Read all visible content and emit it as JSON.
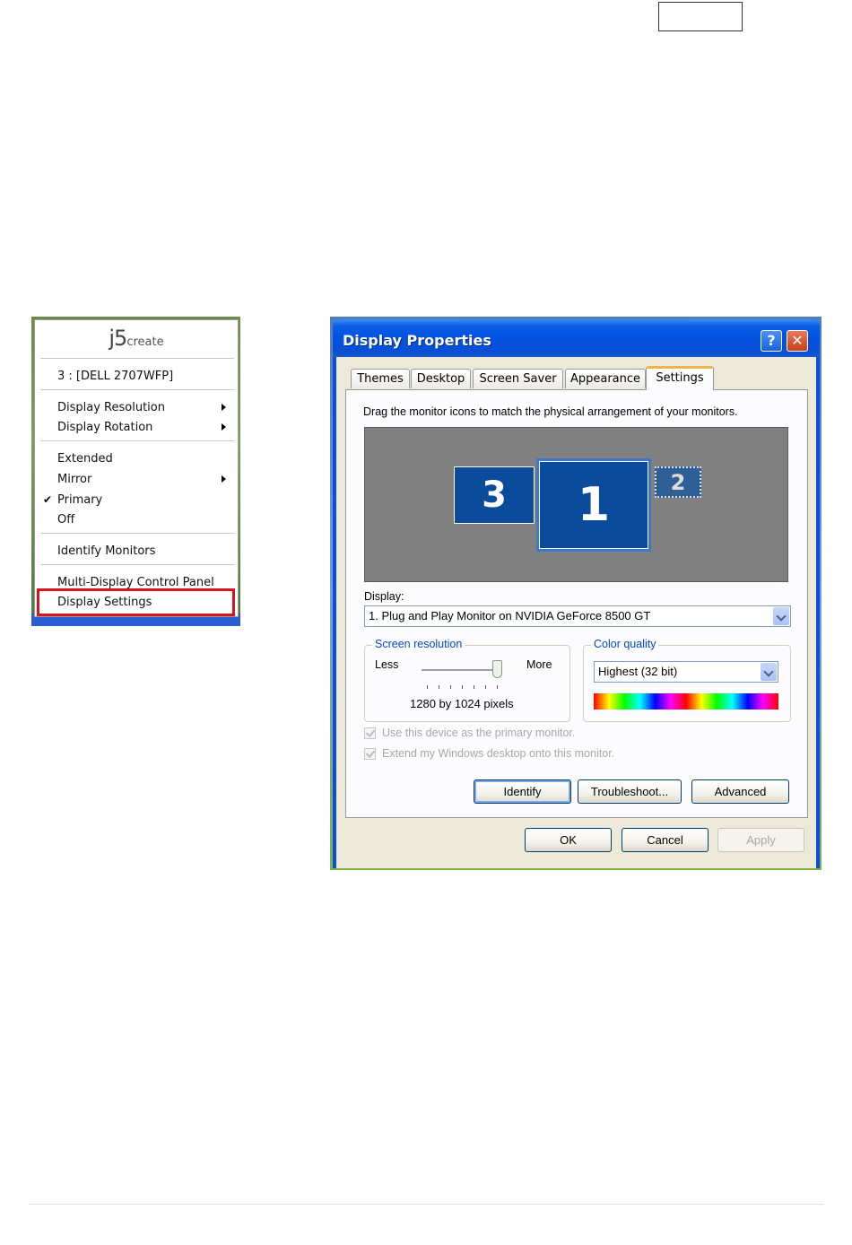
{
  "tray_menu": {
    "logo_j5": "j5",
    "logo_create": "create",
    "device": "3 : [DELL 2707WFP]",
    "display_resolution": "Display Resolution",
    "display_rotation": "Display Rotation",
    "extended": "Extended",
    "mirror": "Mirror",
    "primary": "Primary",
    "off": "Off",
    "identify_monitors": "Identify Monitors",
    "multi_display_control_panel": "Multi-Display Control Panel",
    "display_settings": "Display Settings",
    "checked_item": "Primary",
    "highlight_color": "#d7141e"
  },
  "dialog": {
    "title": "Display Properties",
    "help_glyph": "?",
    "close_glyph": "✕",
    "tabs": [
      {
        "label": "Themes"
      },
      {
        "label": "Desktop"
      },
      {
        "label": "Screen Saver"
      },
      {
        "label": "Appearance"
      },
      {
        "label": "Settings"
      }
    ],
    "active_tab": "Settings",
    "instruction": "Drag the monitor icons to match the physical arrangement of your monitors.",
    "monitors": {
      "m3": "3",
      "m1": "1",
      "m2": "2"
    },
    "display_label": "Display:",
    "display_value": "1. Plug and Play Monitor on NVIDIA GeForce 8500 GT",
    "screen_resolution": {
      "title": "Screen resolution",
      "less": "Less",
      "more": "More",
      "value_text": "1280 by 1024 pixels",
      "slider_level": 1.0
    },
    "color_quality": {
      "title": "Color quality",
      "value": "Highest (32 bit)"
    },
    "check_primary": "Use this device as the primary monitor.",
    "check_extend": "Extend my Windows desktop onto this monitor.",
    "buttons": {
      "identify": "Identify",
      "troubleshoot": "Troubleshoot...",
      "advanced": "Advanced",
      "ok": "OK",
      "cancel": "Cancel",
      "apply": "Apply"
    },
    "title_bar_color": "#0053e0",
    "group_title_color": "#0046d5"
  }
}
